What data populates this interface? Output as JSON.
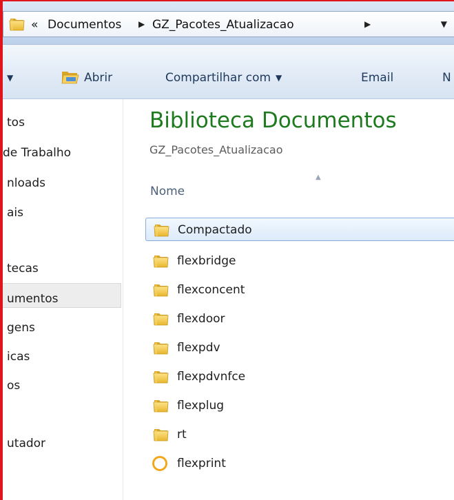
{
  "address": {
    "overflow_chevron": "«",
    "crumbs": [
      "Documentos",
      "GZ_Pacotes_Atualizacao"
    ],
    "separator": "▶",
    "dropdown": "▼"
  },
  "toolbar": {
    "organize_dropdown": "▼",
    "open_label": "Abrir",
    "share_label": "Compartilhar com",
    "share_dropdown": "▼",
    "email_label": "Email",
    "next_label_partial": "N"
  },
  "nav": {
    "items": [
      "tos",
      " de Trabalho",
      "nloads",
      "ais",
      "tecas",
      "umentos",
      "gens",
      "icas",
      "os",
      "utador"
    ],
    "selected_index": 5
  },
  "content": {
    "library_title": "Biblioteca Documentos",
    "library_subtitle": "GZ_Pacotes_Atualizacao",
    "column_name": "Nome",
    "sort_indicator": "▲",
    "files": [
      {
        "name": "Compactado",
        "icon": "folder-icon",
        "selected": true
      },
      {
        "name": "flexbridge",
        "icon": "folder-icon",
        "selected": false
      },
      {
        "name": "flexconcent",
        "icon": "folder-icon",
        "selected": false
      },
      {
        "name": "flexdoor",
        "icon": "folder-icon",
        "selected": false
      },
      {
        "name": "flexpdv",
        "icon": "folder-icon",
        "selected": false
      },
      {
        "name": "flexpdvnfce",
        "icon": "folder-icon",
        "selected": false
      },
      {
        "name": "flexplug",
        "icon": "folder-icon",
        "selected": false
      },
      {
        "name": "rt",
        "icon": "folder-icon",
        "selected": false
      },
      {
        "name": "flexprint",
        "icon": "ring-app-icon",
        "selected": false
      }
    ]
  },
  "colors": {
    "title_green": "#1e7a1e",
    "selection_border": "#84acdd",
    "folder_yellow": "#f2c53d",
    "frame_red": "#e0141b"
  }
}
